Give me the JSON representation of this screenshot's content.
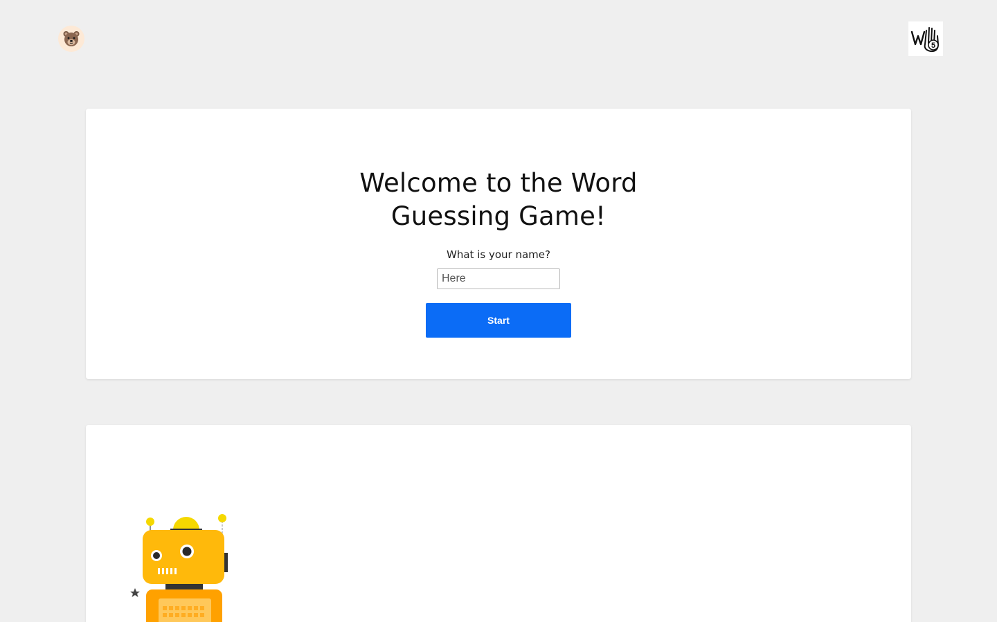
{
  "header": {
    "avatar_icon": "bear-face-icon",
    "brand_logo_icon": "wave-hand-five-logo"
  },
  "welcome": {
    "title": "Welcome to the Word Guessing Game!",
    "name_prompt": "What is your name?",
    "name_input_placeholder": "Here",
    "name_input_value": "",
    "start_label": "Start"
  },
  "illustration": {
    "icon": "robot-icon"
  },
  "colors": {
    "background": "#efefef",
    "card": "#ffffff",
    "primary_button": "#0b6cf6",
    "robot_head": "#ffb90b",
    "robot_body": "#ffa100",
    "robot_antenna": "#f5d800"
  }
}
